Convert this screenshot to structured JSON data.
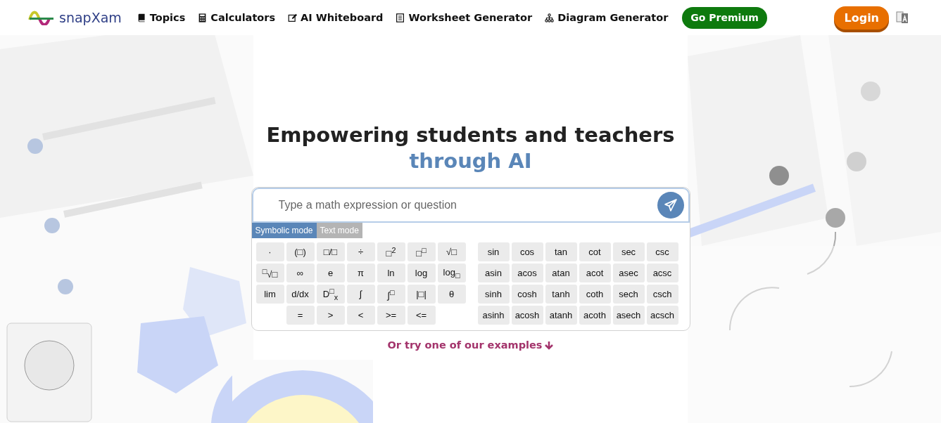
{
  "nav": {
    "brand": "snapXam",
    "links": [
      {
        "kind": "book",
        "label": "Topics"
      },
      {
        "kind": "calculator",
        "label": "Calculators"
      },
      {
        "kind": "pen",
        "label": "AI Whiteboard"
      },
      {
        "kind": "sheet",
        "label": "Worksheet Generator"
      },
      {
        "kind": "sitemap",
        "label": "Diagram Generator"
      }
    ],
    "premium": "Go Premium",
    "login": "Login"
  },
  "hero": {
    "title": "Empowering students and teachers",
    "highlight": "through AI"
  },
  "search": {
    "placeholder": "Type a math expression or question"
  },
  "modes": [
    {
      "label": "Symbolic mode",
      "selected": true
    },
    {
      "label": "Text mode",
      "selected": false
    }
  ],
  "symbol_keys": [
    [
      "·",
      "(□)",
      "□/□",
      "÷",
      "□$^{2}$",
      "□$^{□}$",
      "√□"
    ],
    [
      "$^{□}$√□",
      "∞",
      "e",
      "π",
      "ln",
      "log",
      "log$_{□}$"
    ],
    [
      "lim",
      "d/dx",
      "D$^{□}$$_{x}$",
      "∫",
      "∫$^{□}$",
      "|□|",
      "θ"
    ],
    [
      "=",
      ">",
      "<",
      ">=",
      "<="
    ]
  ],
  "trig_keys": [
    [
      "sin",
      "cos",
      "tan",
      "cot",
      "sec",
      "csc"
    ],
    [
      "asin",
      "acos",
      "atan",
      "acot",
      "asec",
      "acsc"
    ],
    [
      "sinh",
      "cosh",
      "tanh",
      "coth",
      "sech",
      "csch"
    ],
    [
      "asinh",
      "acosh",
      "atanh",
      "acoth",
      "asech",
      "acsch"
    ]
  ],
  "examples_link": "Or try one of our examples"
}
